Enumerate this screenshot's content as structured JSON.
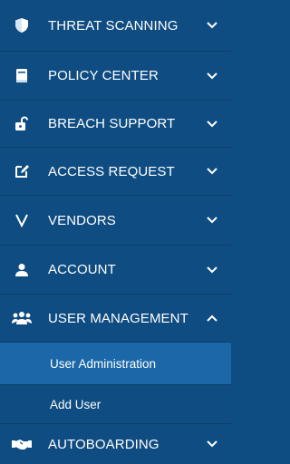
{
  "menu": {
    "items": [
      {
        "label": "THREAT SCANNING",
        "icon": "shield-icon"
      },
      {
        "label": "POLICY CENTER",
        "icon": "book-icon"
      },
      {
        "label": "BREACH SUPPORT",
        "icon": "unlock-icon"
      },
      {
        "label": "ACCESS REQUEST",
        "icon": "edit-icon"
      },
      {
        "label": "VENDORS",
        "icon": "v-icon"
      },
      {
        "label": "ACCOUNT",
        "icon": "user-icon"
      },
      {
        "label": "USER MANAGEMENT",
        "icon": "users-icon"
      },
      {
        "label": "AUTOBOARDING",
        "icon": "handshake-icon"
      }
    ],
    "submenu": [
      {
        "label": "User Administration",
        "active": true
      },
      {
        "label": "Add User",
        "active": false
      }
    ]
  },
  "colors": {
    "background": "#0f4c81",
    "active_sub": "#1b67a8",
    "divider": "#0a3f6c",
    "text": "#ffffff"
  }
}
